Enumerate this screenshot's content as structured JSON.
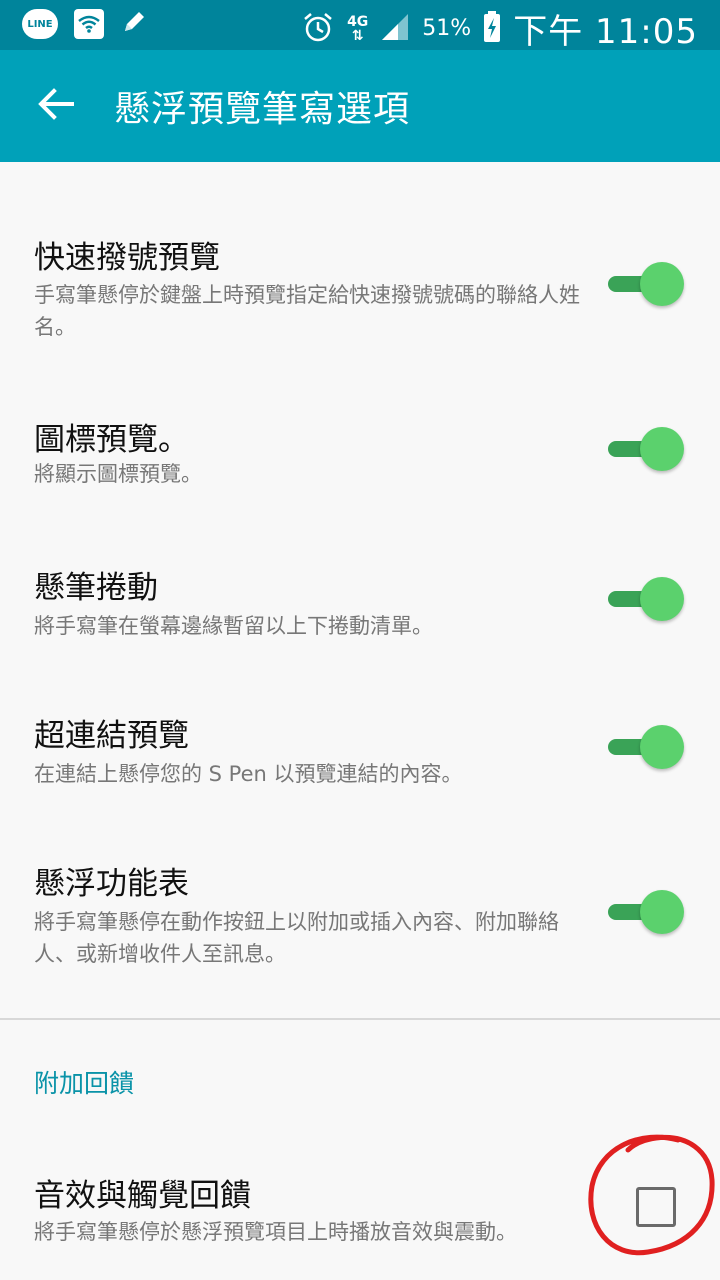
{
  "status_bar": {
    "line_label": "LINE",
    "network": "4G",
    "battery": "51%",
    "time": "下午 11:05"
  },
  "app_bar": {
    "title": "懸浮預覽筆寫選項",
    "back_icon": "arrow-left-icon"
  },
  "settings": [
    {
      "title": "快速撥號預覽",
      "desc": "手寫筆懸停於鍵盤上時預覽指定給快速撥號號碼的聯絡人姓名。",
      "enabled": true
    },
    {
      "title": "圖標預覽。",
      "desc": "將顯示圖標預覽。",
      "enabled": true
    },
    {
      "title": "懸筆捲動",
      "desc": "將手寫筆在螢幕邊緣暫留以上下捲動清單。",
      "enabled": true
    },
    {
      "title": "超連結預覽",
      "desc": "在連結上懸停您的 S Pen 以預覽連結的內容。",
      "enabled": true
    },
    {
      "title": "懸浮功能表",
      "desc": "將手寫筆懸停在動作按鈕上以附加或插入內容、附加聯絡人、或新增收件人至訊息。",
      "enabled": true
    }
  ],
  "section": {
    "header": "附加回饋",
    "item": {
      "title": "音效與觸覺回饋",
      "desc": "將手寫筆懸停於懸浮預覽項目上時播放音效與震動。",
      "checked": false
    }
  },
  "colors": {
    "status_bar": "#00849b",
    "app_bar": "#00a1b9",
    "switch_on": "#5bd16d",
    "section_header": "#0a93a8",
    "annotation": "#e02020"
  }
}
